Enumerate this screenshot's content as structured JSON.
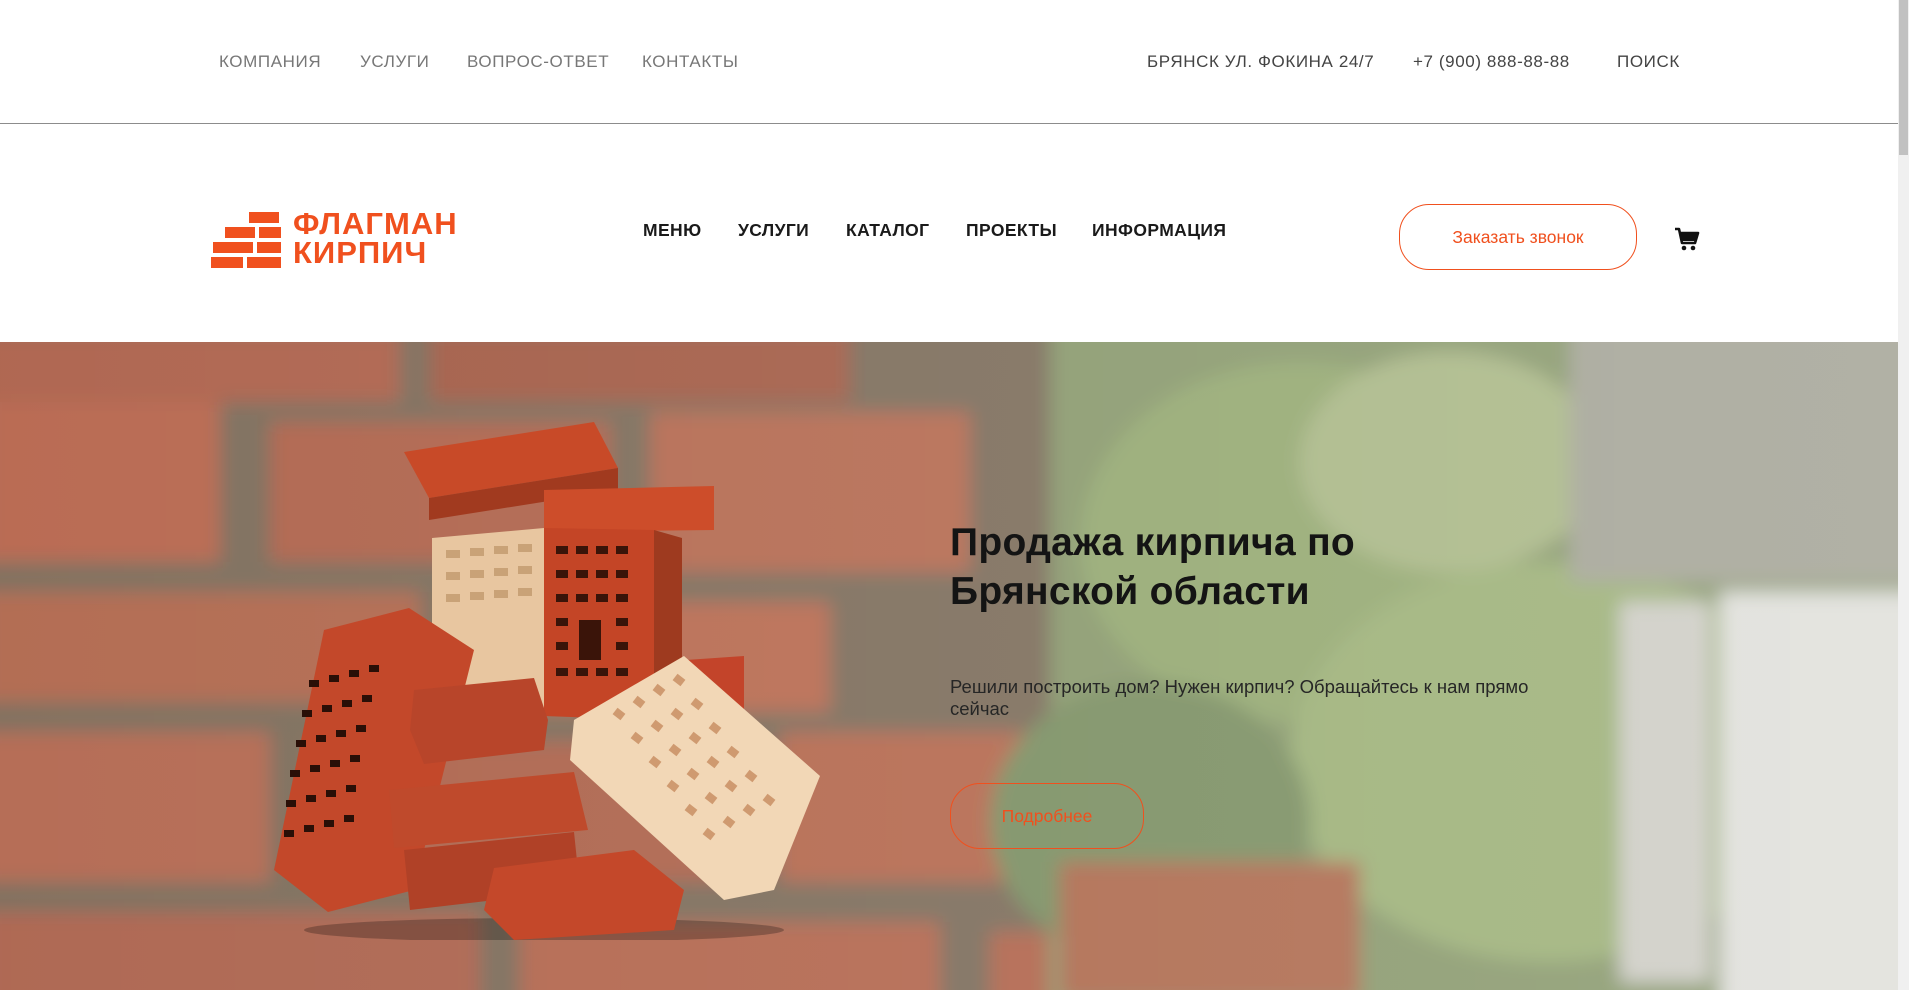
{
  "topbar": {
    "links": [
      "КОМПАНИЯ",
      "УСЛУГИ",
      "ВОПРОС-ОТВЕТ",
      "КОНТАКТЫ"
    ],
    "address": "БРЯНСК УЛ. ФОКИНА 24/7",
    "phone": "+7 (900) 888-88-88",
    "search": "ПОИСК"
  },
  "logo": {
    "line1": "ФЛАГМАН",
    "line2": "КИРПИЧ"
  },
  "nav": [
    "МЕНЮ",
    "УСЛУГИ",
    "КАТАЛОГ",
    "ПРОЕКТЫ",
    "ИНФОРМАЦИЯ"
  ],
  "header": {
    "call_label": "Заказать звонок",
    "cart_icon": "cart-icon"
  },
  "hero": {
    "title": "Продажа кирпича по Брянской области",
    "subtitle": "Решили построить дом? Нужен кирпич? Обращайтесь к нам прямо сейчас",
    "button": "Подробнее"
  },
  "colors": {
    "accent": "#f0501e",
    "text": "#141414",
    "muted": "#777777"
  }
}
